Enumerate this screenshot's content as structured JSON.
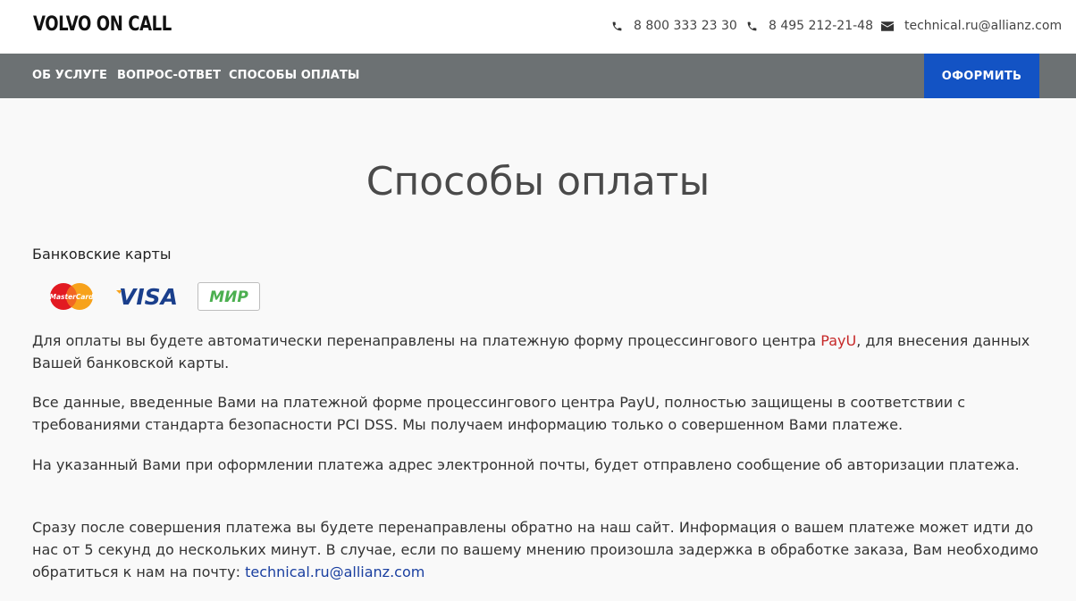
{
  "header": {
    "logo": "VOLVO ON CALL",
    "phone1": "8 800 333 23 30",
    "phone2": "8 495 212-21-48",
    "email": "technical.ru@allianz.com"
  },
  "nav": {
    "items": [
      "ОБ УСЛУГЕ",
      "ВОПРОС-ОТВЕТ",
      "СПОСОБЫ ОПЛАТЫ"
    ],
    "cta": "ОФОРМИТЬ"
  },
  "main": {
    "title": "Способы оплаты",
    "section_label": "Банковские карты",
    "cards": [
      "MasterCard",
      "VISA",
      "МИР"
    ],
    "p1_before": "Для оплаты вы будете автоматически перенаправлены на платежную форму процессингового центра ",
    "p1_link": "PayU",
    "p1_after": ", для внесения данных Вашей банковской карты.",
    "p2": "Все данные, введенные Вами на платежной форме процессингового центра PayU, полностью защищены в соответствии с требованиями стандарта безопасности PCI DSS. Мы получаем информацию только о совершенном Вами платеже.",
    "p3": "На указанный Вами при оформлении платежа адрес электронной почты, будет отправлено сообщение об авторизации платежа.",
    "p4_before": "Сразу после совершения платежа вы будете перенаправлены обратно на наш сайт. Информация о вашем платеже может идти до нас от 5 секунд до нескольких минут. В случае, если по вашему мнению произошла задержка в обработке заказа, Вам необходимо обратиться к нам на почту: ",
    "p4_link": "technical.ru@allianz.com"
  },
  "colors": {
    "nav_bg": "#6c7173",
    "cta_bg": "#1353c4",
    "link_red": "#c62828",
    "link_blue": "#1a3fa0"
  },
  "icons": [
    "phone-icon",
    "phone-icon",
    "mail-icon"
  ]
}
